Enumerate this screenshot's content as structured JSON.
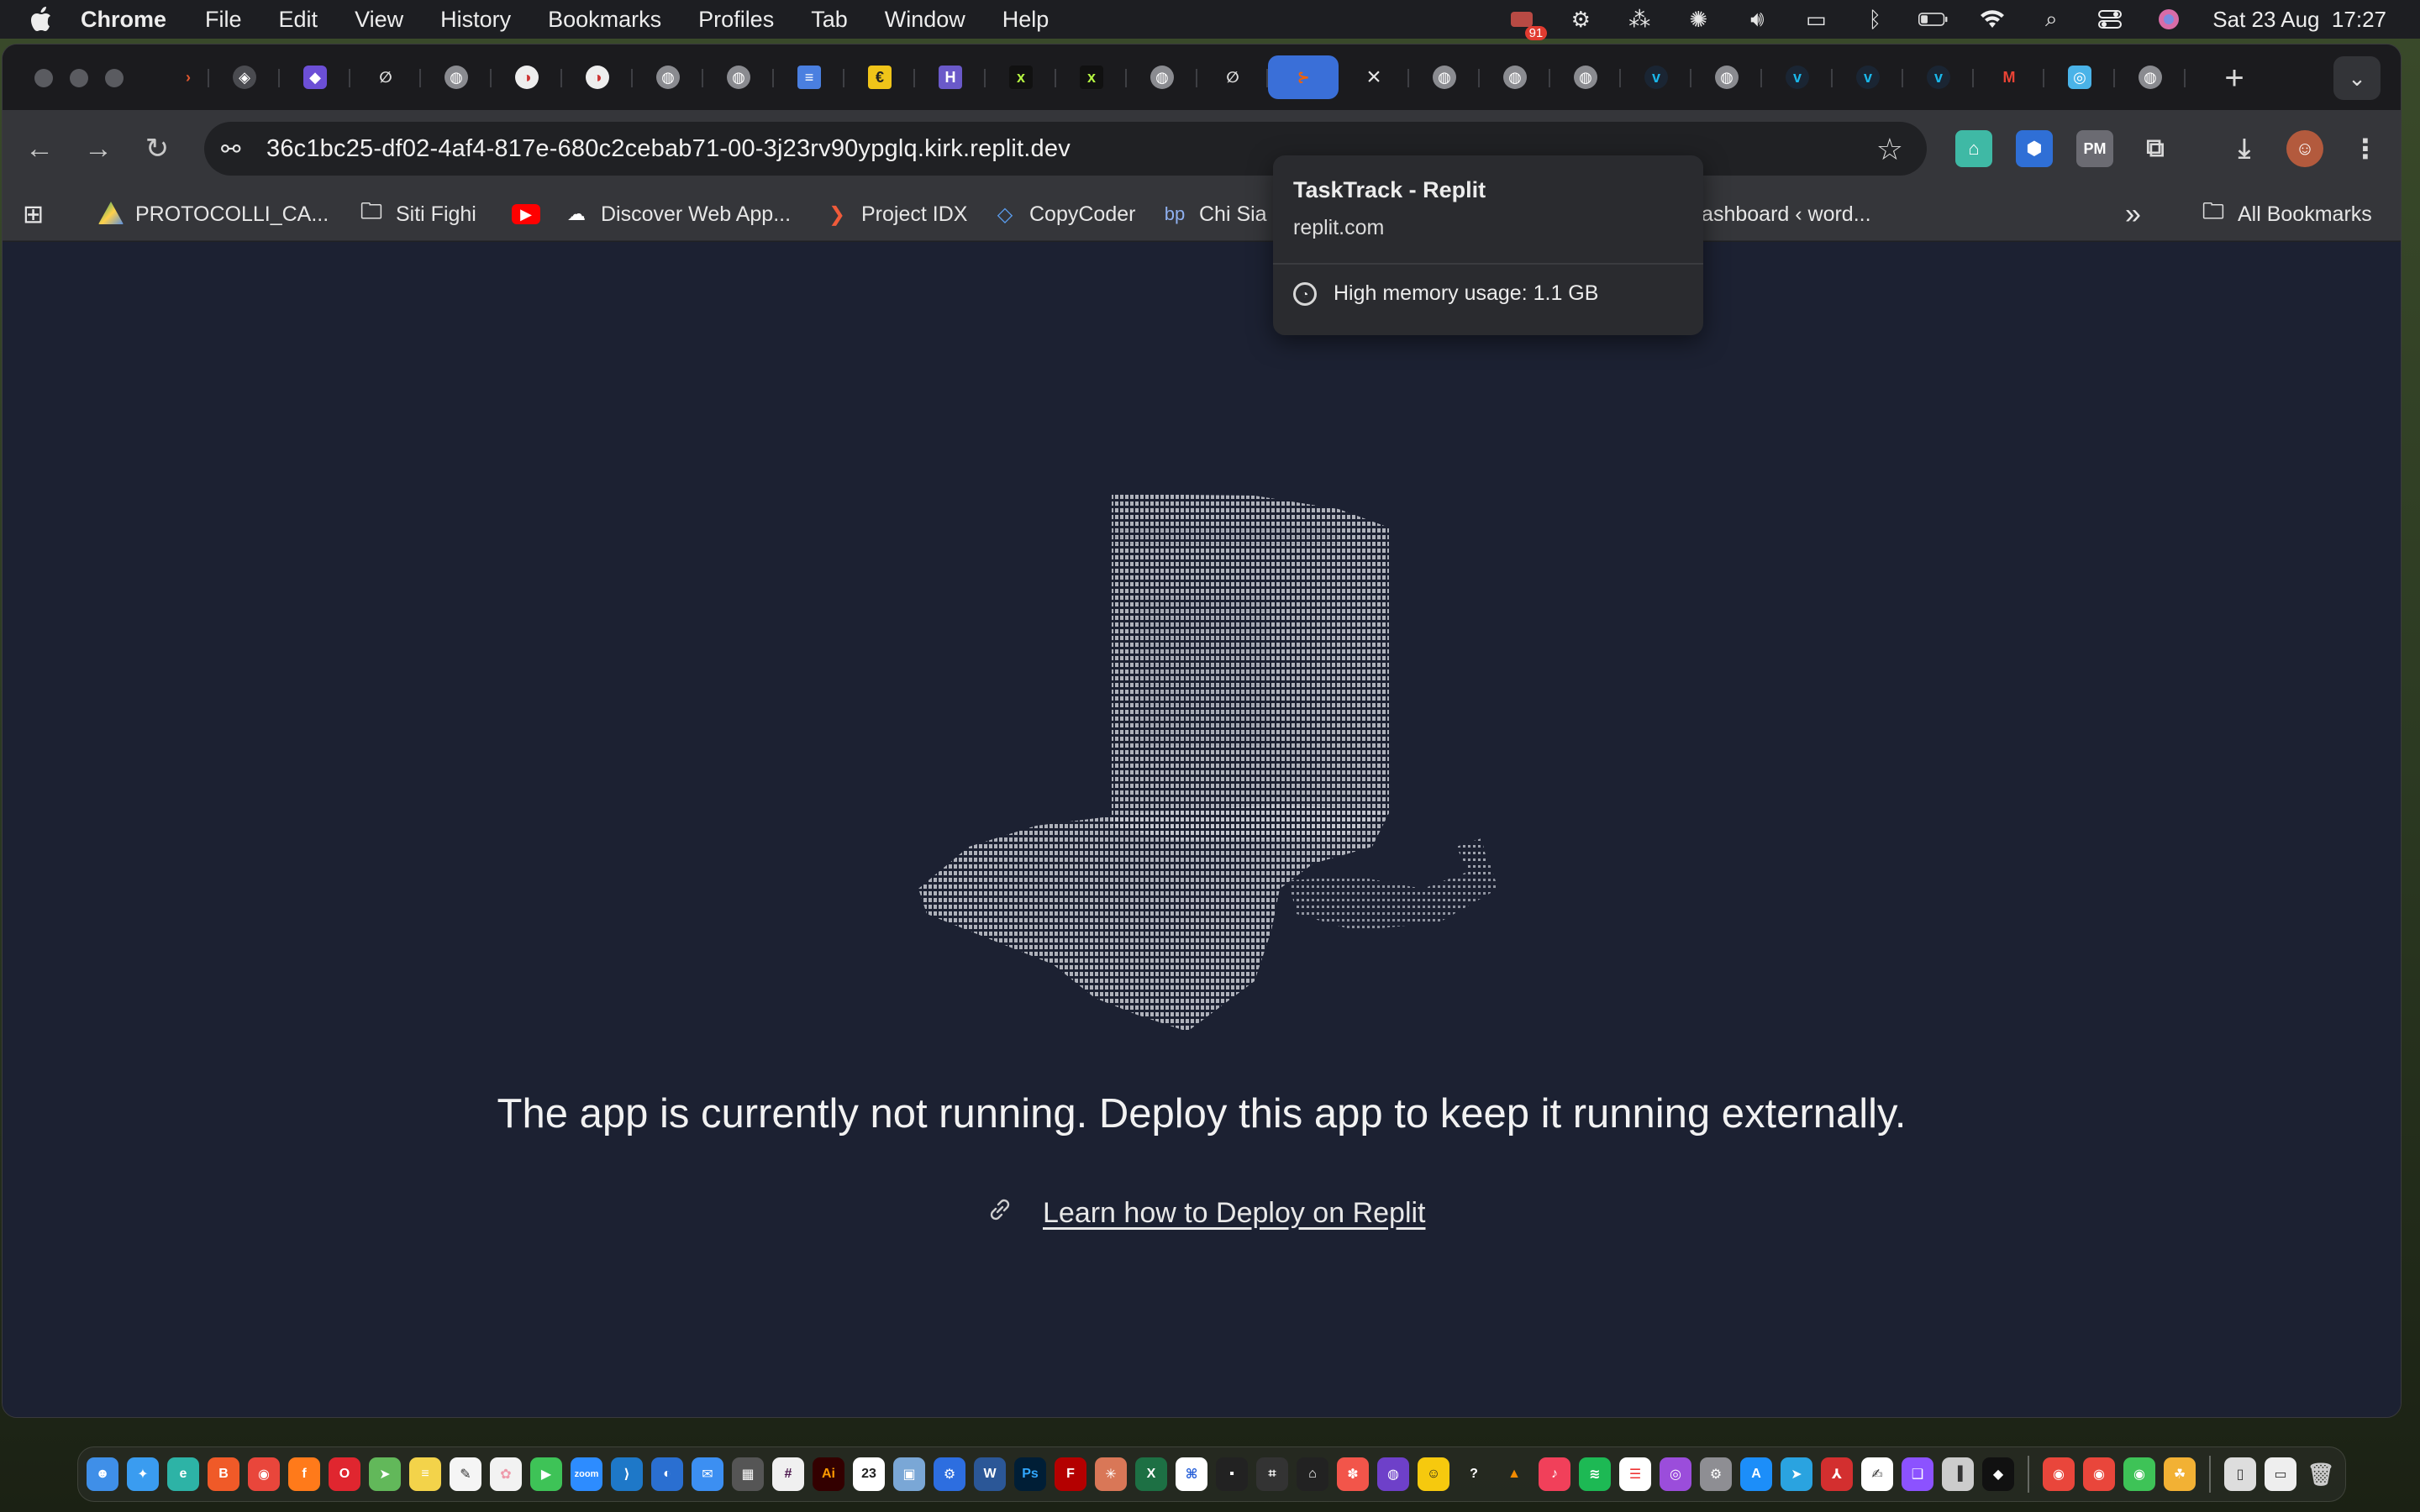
{
  "menubar": {
    "app": "Chrome",
    "items": [
      "File",
      "Edit",
      "View",
      "History",
      "Bookmarks",
      "Profiles",
      "Tab",
      "Window",
      "Help"
    ],
    "notification_count": "91",
    "datetime": "Sat 23 Aug  17:27"
  },
  "browser": {
    "url": "36c1bc25-df02-4af4-817e-680c2cebab71-00-3j23rv90ypglq.kirk.replit.dev",
    "bookmarks": [
      {
        "label": "PROTOCOLLI_CA...",
        "icon": "google-drive-icon"
      },
      {
        "label": "Siti Fighi",
        "icon": "folder-icon"
      },
      {
        "label": "",
        "icon": "youtube-icon"
      },
      {
        "label": "Discover Web App...",
        "icon": "webapp-icon"
      },
      {
        "label": "Project IDX",
        "icon": "idx-icon"
      },
      {
        "label": "CopyCoder",
        "icon": "copycoder-icon"
      },
      {
        "label": "Chi Sia",
        "icon": "bp-icon"
      },
      {
        "label": "Dashboard ‹ word...",
        "icon": "wordpress-icon"
      }
    ],
    "overflow_label": "»",
    "all_bookmarks": "All Bookmarks"
  },
  "hovercard": {
    "title": "TaskTrack - Replit",
    "domain": "replit.com",
    "memory": "High memory usage: 1.1 GB"
  },
  "page": {
    "message": "The app is currently not running. Deploy this app to keep it running externally.",
    "link": "Learn how to Deploy on Replit"
  },
  "colors": {
    "page_bg": "#1c2132",
    "toolbar_bg": "#35363a",
    "tabstrip_bg": "#1b1b1e",
    "active_tab": "#3a6fd8"
  }
}
